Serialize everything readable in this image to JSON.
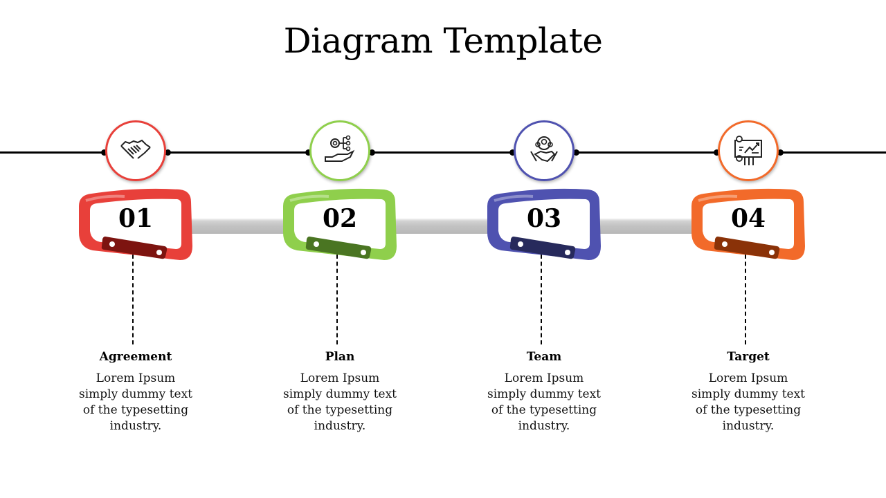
{
  "title": "Diagram Template",
  "steps": [
    {
      "number": "01",
      "heading": "Agreement",
      "desc": "Lorem Ipsum simply dummy text of the typesetting industry.",
      "icon": "handshake-icon",
      "color": "#e8403a",
      "dark": "#7d1410"
    },
    {
      "number": "02",
      "heading": "Plan",
      "desc": "Lorem Ipsum simply dummy text of the typesetting industry.",
      "icon": "gear-hand-network-icon",
      "color": "#8fcf4c",
      "dark": "#4a7522"
    },
    {
      "number": "03",
      "heading": "Team",
      "desc": "Lorem Ipsum simply dummy text of the typesetting industry.",
      "icon": "team-handshake-icon",
      "color": "#4f52b0",
      "dark": "#272a5c"
    },
    {
      "number": "04",
      "heading": "Target",
      "desc": "Lorem Ipsum simply dummy text of the typesetting industry.",
      "icon": "presentation-growth-icon",
      "color": "#f26a2a",
      "dark": "#8a3208"
    }
  ]
}
